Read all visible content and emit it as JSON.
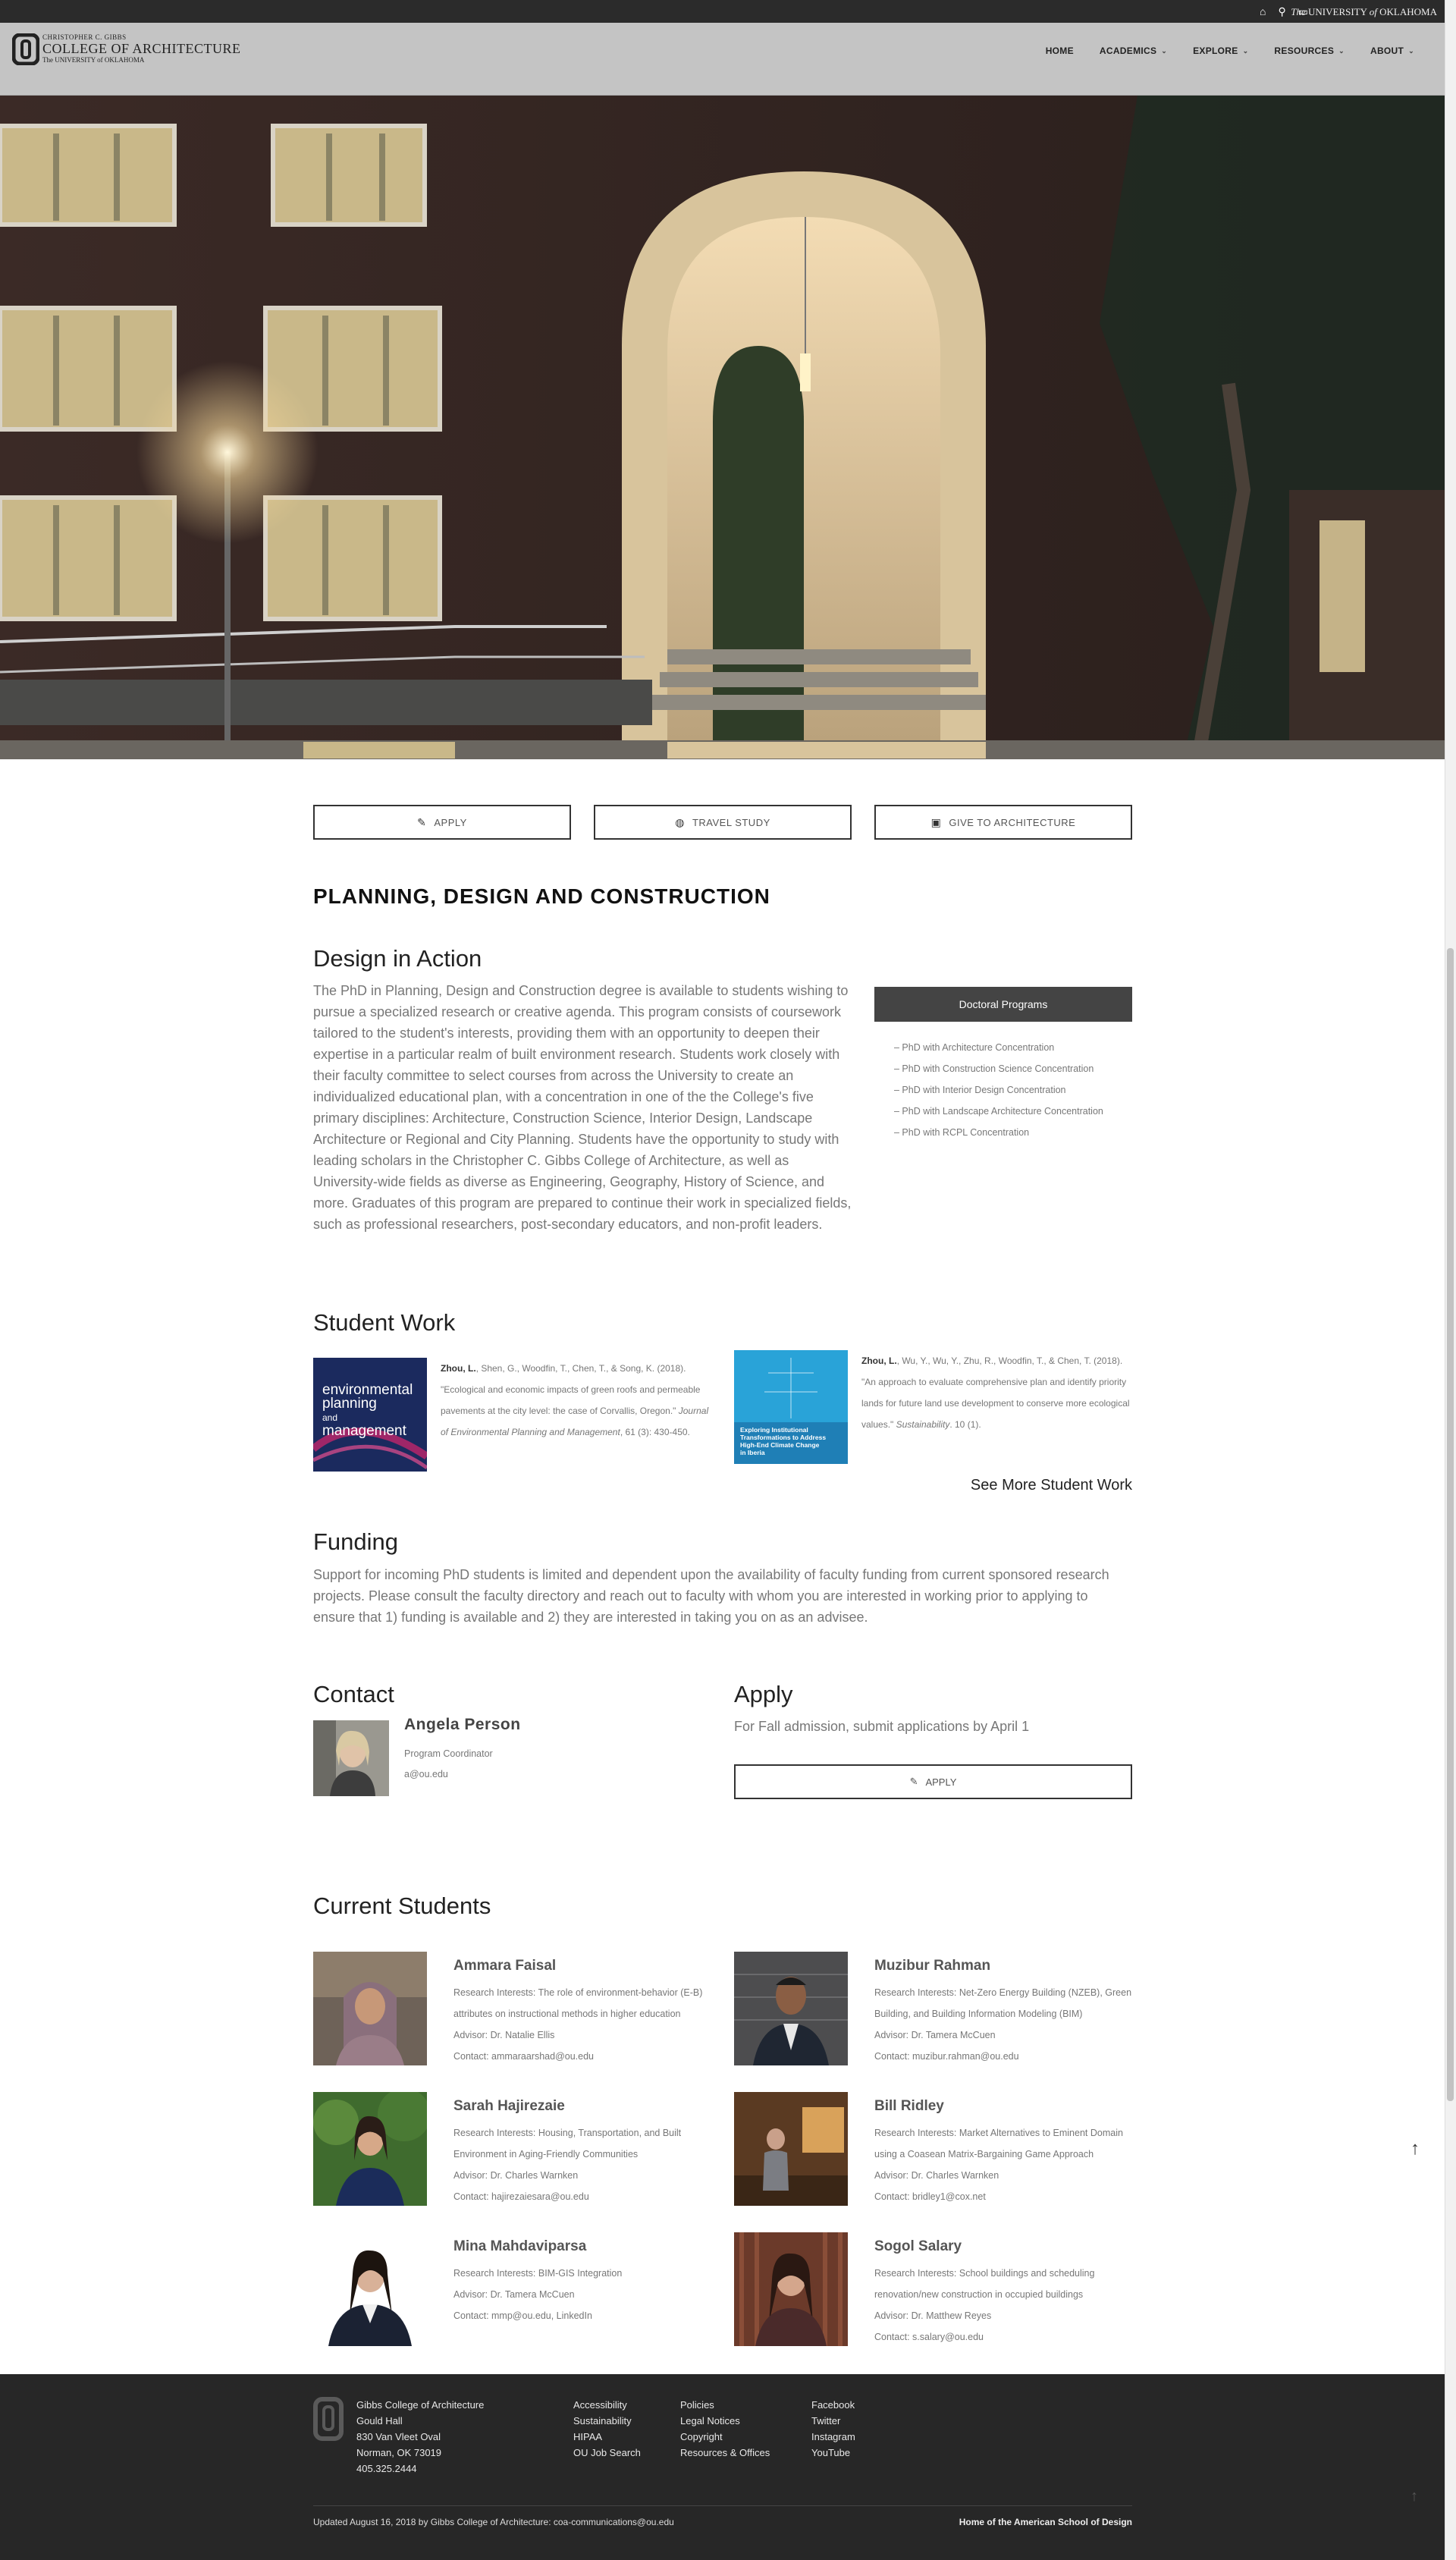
{
  "utility_bar": {
    "icons": [
      "home-icon",
      "search-icon",
      "chat-icon"
    ],
    "ou_prefix": "The",
    "ou_name": "UNIVERSITY",
    "ou_of": "of",
    "ou_state": "OKLAHOMA"
  },
  "header": {
    "logo_subtitle": "CHRISTOPHER C. GIBBS",
    "logo_title": "COLLEGE OF ARCHITECTURE",
    "logo_ou": "The UNIVERSITY of OKLAHOMA",
    "nav": [
      {
        "label": "HOME",
        "dropdown": false
      },
      {
        "label": "ACADEMICS",
        "dropdown": true
      },
      {
        "label": "EXPLORE",
        "dropdown": true
      },
      {
        "label": "RESOURCES",
        "dropdown": true
      },
      {
        "label": "ABOUT",
        "dropdown": true
      }
    ]
  },
  "actions": {
    "apply": "APPLY",
    "travel": "TRAVEL STUDY",
    "give": "GIVE TO ARCHITECTURE"
  },
  "page_title": "PLANNING, DESIGN AND CONSTRUCTION",
  "design": {
    "heading": "Design in Action",
    "body": "The PhD in Planning, Design and Construction degree is available to students wishing to pursue a specialized research or creative agenda. This program consists of coursework tailored to the student's interests, providing them with an opportunity to deepen their expertise in a particular realm of built environment research. Students work closely with their faculty committee to select courses from across the University to create an individualized educational plan, with a concentration in one of the the College's five primary disciplines: Architecture, Construction Science, Interior Design, Landscape Architecture or Regional and City Planning. Students have the opportunity to study with leading scholars in the Christopher C. Gibbs College of Architecture, as well as University-wide fields as diverse as Engineering, Geography, History of Science, and more. Graduates of this program are prepared to continue their work in specialized fields, such as professional researchers, post-secondary educators, and non-profit leaders."
  },
  "doctoral": {
    "heading": "Doctoral Programs",
    "items": [
      "– PhD with Architecture Concentration",
      "– PhD with Construction Science Concentration",
      "– PhD with Interior Design Concentration",
      "– PhD with Landscape Architecture Concentration",
      "– PhD with RCPL Concentration"
    ]
  },
  "student_work": {
    "heading": "Student Work",
    "items": [
      {
        "author": "Zhou, L.",
        "rest": ", Shen, G., Woodfin, T., Chen, T., & Song, K. (2018). \"Ecological and economic impacts of green roofs and permeable pavements at the city level: the case of Corvallis, Oregon.\"",
        "journal": "Journal of Environmental Planning and Management",
        "tail": ", 61 (3): 430-450.",
        "cover_lines": [
          "environmental",
          "planning",
          "and",
          "management"
        ]
      },
      {
        "author": "Zhou, L.",
        "rest": ", Wu, Y., Wu, Y., Zhu, R., Woodfin, T., & Chen, T. (2018). \"An approach to evaluate comprehensive plan and identify priority lands for future land use development to conserve more ecological values.\"",
        "journal": "Sustainability",
        "tail": ". 10 (1).",
        "cover_lines": [
          "Exploring Institutional",
          "Transformations to Address",
          "High-End Climate Change",
          "in Iberia"
        ]
      }
    ],
    "see_more": "See More Student Work"
  },
  "funding": {
    "heading": "Funding",
    "body": "Support for incoming PhD students is limited and dependent upon the availability of faculty funding from current sponsored research projects. Please consult the faculty directory and reach out to faculty with whom you are interested in working prior to applying to ensure that 1) funding is available and 2) they are interested in taking you on as an advisee."
  },
  "contact": {
    "heading": "Contact",
    "name": "Angela Person",
    "role": "Program Coordinator",
    "email": "a@ou.edu"
  },
  "apply": {
    "heading": "Apply",
    "text": "For Fall admission, submit applications by April 1",
    "button": "APPLY"
  },
  "current_students": {
    "heading": "Current Students",
    "list": [
      {
        "name": "Ammara Faisal",
        "lines": [
          "Research Interests: The role of environment-behavior (E-B) attributes on instructional methods in higher education",
          "Advisor: Dr. Natalie Ellis",
          "Contact: ammaraarshad@ou.edu"
        ]
      },
      {
        "name": "Muzibur Rahman",
        "lines": [
          "Research Interests: Net-Zero Energy Building (NZEB), Green Building, and Building Information Modeling (BIM)",
          "Advisor: Dr. Tamera McCuen",
          "Contact: muzibur.rahman@ou.edu"
        ]
      },
      {
        "name": "Sarah Hajirezaie",
        "lines": [
          "Research Interests: Housing, Transportation, and Built Environment in Aging-Friendly Communities",
          "Advisor: Dr. Charles Warnken",
          "Contact: hajirezaiesara@ou.edu"
        ]
      },
      {
        "name": "Bill Ridley",
        "lines": [
          "Research Interests: Market Alternatives to Eminent Domain using a Coasean Matrix-Bargaining Game Approach",
          "Advisor: Dr. Charles Warnken",
          "Contact: bridley1@cox.net"
        ]
      },
      {
        "name": "Mina Mahdaviparsa",
        "lines": [
          "Research Interests: BIM-GIS Integration",
          "Advisor: Dr. Tamera McCuen",
          "Contact: mmp@ou.edu, LinkedIn"
        ]
      },
      {
        "name": "Sogol Salary",
        "lines": [
          "Research Interests: School buildings and scheduling renovation/new construction in occupied buildings",
          "Advisor: Dr. Matthew Reyes",
          "Contact: s.salary@ou.edu"
        ]
      }
    ]
  },
  "footer": {
    "address": [
      "Gibbs College of Architecture",
      "Gould Hall",
      "830 Van Vleet Oval",
      "Norman, OK 73019",
      "405.325.2444"
    ],
    "col1": [
      "Accessibility",
      "Sustainability",
      "HIPAA",
      "OU Job Search"
    ],
    "col2": [
      "Policies",
      "Legal Notices",
      "Copyright",
      "Resources & Offices"
    ],
    "col3": [
      "Facebook",
      "Twitter",
      "Instagram",
      "YouTube"
    ],
    "updated": "Updated August 16, 2018 by Gibbs College of Architecture: coa-communications@ou.edu",
    "home": "Home of the American School of Design"
  },
  "colors": {
    "utility_bar": "#2b2b2b",
    "header": "#c4c4c4",
    "doc_header": "#444444",
    "footer": "#272727"
  }
}
